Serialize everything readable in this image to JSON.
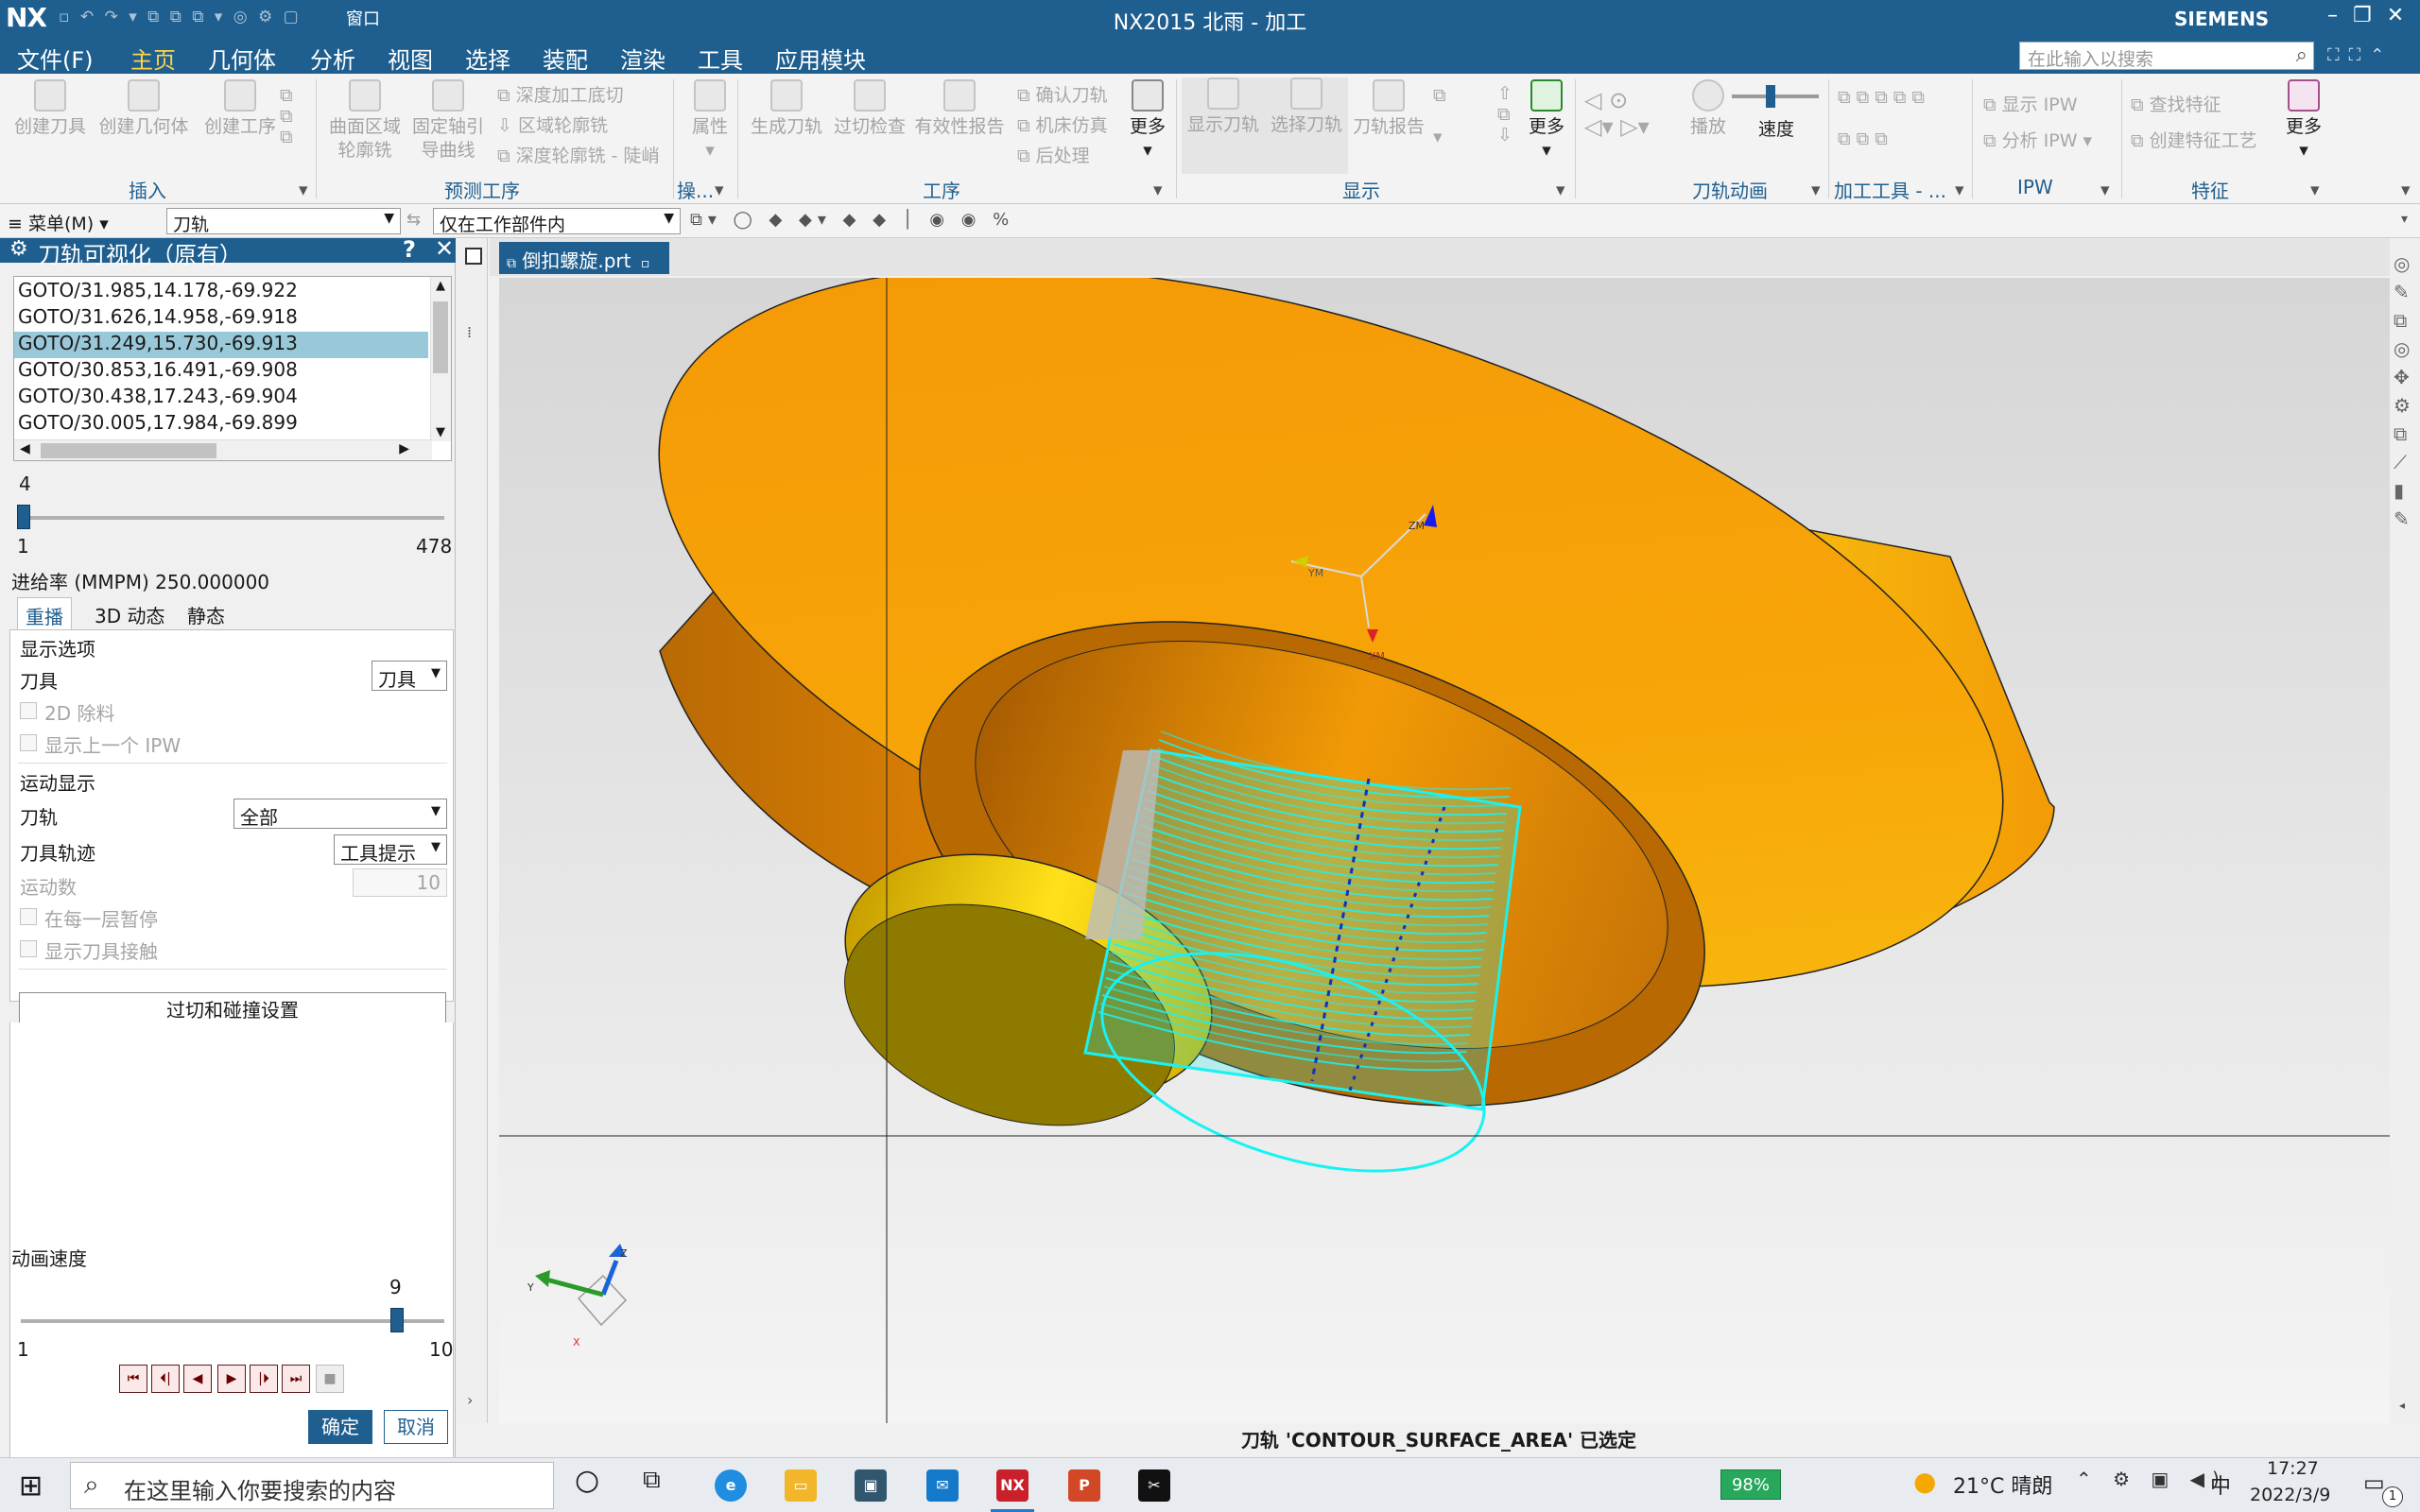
{
  "titlebar": {
    "logo": "NX",
    "quick_access": "▫ ↶ ↷ ▾ ⧉ ⧉ ⧉ ▾ ◎ ⚙ ▢",
    "window_menu": "窗口",
    "title": "NX2015 北雨 - 加工",
    "brand": "SIEMENS",
    "controls": "–❐✕"
  },
  "menubar": {
    "items": [
      "文件(F)",
      "主页",
      "几何体",
      "分析",
      "视图",
      "选择",
      "装配",
      "渲染",
      "工具",
      "应用模块"
    ],
    "search_placeholder": "在此输入以搜索"
  },
  "ribbon": {
    "insert": {
      "btn1": "创建刀具",
      "btn2": "创建几何体",
      "btn3": "创建工序",
      "group": "插入"
    },
    "predict": {
      "btn1": "曲面区域",
      "btn1b": "轮廓铣",
      "btn2": "固定轴引",
      "btn2b": "导曲线",
      "small1": "深度加工底切",
      "small2": "区域轮廓铣",
      "small3": "深度轮廓铣 - 陡峭",
      "group": "预测工序"
    },
    "ops": {
      "btn1": "属性",
      "group": "操..."
    },
    "process": {
      "btn1": "生成刀轨",
      "btn2": "过切检查",
      "btn3": "有效性报告",
      "small1": "确认刀轨",
      "small2": "机床仿真",
      "small3": "后处理",
      "more": "更多",
      "group": "工序"
    },
    "display": {
      "btn1": "显示刀轨",
      "btn2": "选择刀轨",
      "btn3": "刀轨报告",
      "more": "更多",
      "group": "显示"
    },
    "anim": {
      "play": "播放",
      "speed": "速度",
      "group": "刀轨动画"
    },
    "tools": {
      "group": "加工工具 - ..."
    },
    "ipw": {
      "small1": "显示 IPW",
      "small2": "分析 IPW",
      "group": "IPW"
    },
    "feature": {
      "small1": "查找特征",
      "small2": "创建特征工艺",
      "more": "更多",
      "group": "特征"
    }
  },
  "toolbar2": {
    "menu": "菜单(M)",
    "filter": "刀轨",
    "scope": "仅在工作部件内"
  },
  "dialog": {
    "title": "刀轨可视化（原有）",
    "help": "?",
    "close": "✕",
    "goto_lines": [
      "GOTO/31.985,14.178,-69.922",
      "GOTO/31.626,14.958,-69.918",
      "GOTO/31.249,15.730,-69.913",
      "GOTO/30.853,16.491,-69.908",
      "GOTO/30.438,17.243,-69.904",
      "GOTO/30.005,17.984,-69.899"
    ],
    "selected_line": 2,
    "position": {
      "value": "4",
      "min": "1",
      "max": "478",
      "fraction": 0.006
    },
    "feedrate": "进给率 (MMPM) 250.000000",
    "tabs": [
      "重播",
      "3D 动态",
      "静态"
    ],
    "display_options": "显示选项",
    "tool_label": "刀具",
    "tool_value": "刀具",
    "removal_2d": "2D 除料",
    "show_prev_ipw": "显示上一个 IPW",
    "motion_display": "运动显示",
    "toolpath_label": "刀轨",
    "toolpath_value": "全部",
    "tool_trace_label": "刀具轨迹",
    "tool_trace_value": "工具提示",
    "motion_count_label": "运动数",
    "motion_count_value": "10",
    "pause_each_layer": "在每一层暂停",
    "show_contact": "显示刀具接触",
    "gouge_button": "过切和碰撞设置",
    "anim_speed_label": "动画速度",
    "anim_speed": {
      "value": "9",
      "min": "1",
      "max": "10",
      "fraction": 0.889
    },
    "ok": "确定",
    "cancel": "取消"
  },
  "graphics": {
    "tab_label": "倒扣螺旋.prt",
    "axes_wcs": {
      "z": "ZM",
      "y": "YM",
      "x": "XM"
    },
    "axes_abs": {
      "z": "Z",
      "y": "Y",
      "x": "X"
    }
  },
  "status_text": "刀轨 'CONTOUR_SURFACE_AREA' 已选定",
  "taskbar": {
    "search_placeholder": "在这里输入你要搜索的内容",
    "battery": "98%",
    "weather": "21°C 晴朗",
    "ime": "中",
    "time": "17:27",
    "date": "2022/3/9",
    "notif": "1"
  },
  "colors": {
    "accent": "#1f5f8f",
    "part_orange": "#f59a05",
    "toolpath_cyan": "#19f2f2",
    "selection": "#99c9d9"
  }
}
